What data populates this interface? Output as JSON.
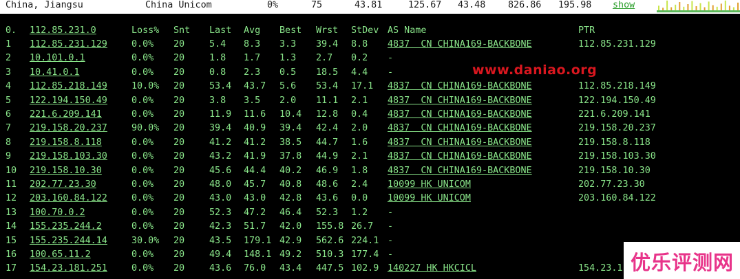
{
  "header": {
    "location": "China, Jiangsu",
    "isp": "China Unicom",
    "loss": "0%",
    "sent": "75",
    "last": "43.81",
    "worst": "125.67",
    "best": "43.48",
    "stdev_like": "826.86",
    "extra": "195.98",
    "show_link": "show"
  },
  "columns": {
    "hop0": "0.",
    "host0": "112.85.231.0",
    "loss": "Loss%",
    "snt": "Snt",
    "last": "Last",
    "avg": "Avg",
    "best": "Best",
    "wrst": "Wrst",
    "stdev": "StDev",
    "as": "AS Name",
    "ptr": "PTR"
  },
  "rows": [
    {
      "hop": "1",
      "ip": "112.85.231.129",
      "loss": "0.0%",
      "snt": "20",
      "last": "5.4",
      "avg": "8.3",
      "best": "3.3",
      "wrst": "39.4",
      "stdev": "8.8",
      "as": "4837  CN CHINA169-BACKBONE",
      "ptr": "112.85.231.129"
    },
    {
      "hop": "2",
      "ip": "10.101.0.1",
      "loss": "0.0%",
      "snt": "20",
      "last": "1.8",
      "avg": "1.7",
      "best": "1.3",
      "wrst": "2.7",
      "stdev": "0.2",
      "as": "-",
      "ptr": ""
    },
    {
      "hop": "3",
      "ip": "10.41.0.1",
      "loss": "0.0%",
      "snt": "20",
      "last": "0.8",
      "avg": "2.3",
      "best": "0.5",
      "wrst": "18.5",
      "stdev": "4.4",
      "as": "-",
      "ptr": ""
    },
    {
      "hop": "4",
      "ip": "112.85.218.149",
      "loss": "10.0%",
      "snt": "20",
      "last": "53.4",
      "avg": "43.7",
      "best": "5.6",
      "wrst": "53.4",
      "stdev": "17.1",
      "as": "4837  CN CHINA169-BACKBONE",
      "ptr": "112.85.218.149"
    },
    {
      "hop": "5",
      "ip": "122.194.150.49",
      "loss": "0.0%",
      "snt": "20",
      "last": "3.8",
      "avg": "3.5",
      "best": "2.0",
      "wrst": "11.1",
      "stdev": "2.1",
      "as": "4837  CN CHINA169-BACKBONE",
      "ptr": "122.194.150.49"
    },
    {
      "hop": "6",
      "ip": "221.6.209.141",
      "loss": "0.0%",
      "snt": "20",
      "last": "11.9",
      "avg": "11.6",
      "best": "10.4",
      "wrst": "12.8",
      "stdev": "0.4",
      "as": "4837  CN CHINA169-BACKBONE",
      "ptr": "221.6.209.141"
    },
    {
      "hop": "7",
      "ip": "219.158.20.237",
      "loss": "90.0%",
      "snt": "20",
      "last": "39.4",
      "avg": "40.9",
      "best": "39.4",
      "wrst": "42.4",
      "stdev": "2.0",
      "as": "4837  CN CHINA169-BACKBONE",
      "ptr": "219.158.20.237"
    },
    {
      "hop": "8",
      "ip": "219.158.8.118",
      "loss": "0.0%",
      "snt": "20",
      "last": "41.2",
      "avg": "41.2",
      "best": "38.5",
      "wrst": "44.7",
      "stdev": "1.6",
      "as": "4837  CN CHINA169-BACKBONE",
      "ptr": "219.158.8.118"
    },
    {
      "hop": "9",
      "ip": "219.158.103.30",
      "loss": "0.0%",
      "snt": "20",
      "last": "43.2",
      "avg": "41.9",
      "best": "37.8",
      "wrst": "44.9",
      "stdev": "2.1",
      "as": "4837  CN CHINA169-BACKBONE",
      "ptr": "219.158.103.30"
    },
    {
      "hop": "10",
      "ip": "219.158.10.30",
      "loss": "0.0%",
      "snt": "20",
      "last": "45.6",
      "avg": "44.4",
      "best": "40.2",
      "wrst": "46.9",
      "stdev": "1.8",
      "as": "4837  CN CHINA169-BACKBONE",
      "ptr": "219.158.10.30"
    },
    {
      "hop": "11",
      "ip": "202.77.23.30",
      "loss": "0.0%",
      "snt": "20",
      "last": "48.0",
      "avg": "45.7",
      "best": "40.8",
      "wrst": "48.6",
      "stdev": "2.4",
      "as": "10099 HK UNICOM",
      "ptr": "202.77.23.30"
    },
    {
      "hop": "12",
      "ip": "203.160.84.122",
      "loss": "0.0%",
      "snt": "20",
      "last": "43.0",
      "avg": "43.0",
      "best": "42.8",
      "wrst": "43.6",
      "stdev": "0.0",
      "as": "10099 HK UNICOM",
      "ptr": "203.160.84.122"
    },
    {
      "hop": "13",
      "ip": "100.70.0.2",
      "loss": "0.0%",
      "snt": "20",
      "last": "52.3",
      "avg": "47.2",
      "best": "46.4",
      "wrst": "52.3",
      "stdev": "1.2",
      "as": "-",
      "ptr": ""
    },
    {
      "hop": "14",
      "ip": "155.235.244.2",
      "loss": "0.0%",
      "snt": "20",
      "last": "42.3",
      "avg": "51.7",
      "best": "42.0",
      "wrst": "155.8",
      "stdev": "26.7",
      "as": "-",
      "ptr": ""
    },
    {
      "hop": "15",
      "ip": "155.235.244.14",
      "loss": "30.0%",
      "snt": "20",
      "last": "43.5",
      "avg": "179.1",
      "best": "42.9",
      "wrst": "562.6",
      "stdev": "224.1",
      "as": "-",
      "ptr": ""
    },
    {
      "hop": "16",
      "ip": "100.65.11.2",
      "loss": "0.0%",
      "snt": "20",
      "last": "49.4",
      "avg": "148.1",
      "best": "49.2",
      "wrst": "510.3",
      "stdev": "177.4",
      "as": "-",
      "ptr": ""
    },
    {
      "hop": "17",
      "ip": "154.23.181.251",
      "loss": "0.0%",
      "snt": "20",
      "last": "43.6",
      "avg": "76.0",
      "best": "43.4",
      "wrst": "447.5",
      "stdev": "102.9",
      "as": "140227 HK HKCICL",
      "ptr": "154.23.1"
    }
  ],
  "sparkline": {
    "bars": [
      0.45,
      0.25,
      0.95,
      0.3,
      0.55,
      0.8,
      0.35,
      0.6,
      0.9,
      0.4,
      0.7,
      0.3,
      0.85,
      0.5,
      0.35,
      0.65,
      0.95,
      0.45,
      0.3,
      0.75
    ],
    "colors": [
      "#c8e64a",
      "#e0a030",
      "#5ab85a"
    ]
  },
  "watermark": "www.daniao.org",
  "logo": "优乐评测网",
  "colors": {
    "terminal_bg": "#000000",
    "terminal_text": "#8ae68a",
    "watermark": "#d9171f",
    "logo": "#e8348a"
  }
}
